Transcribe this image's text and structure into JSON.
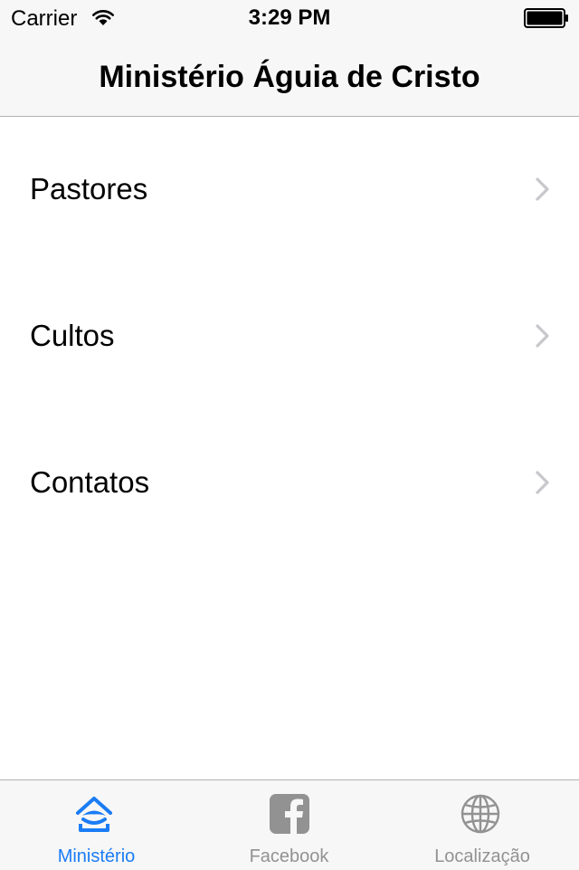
{
  "status_bar": {
    "carrier": "Carrier",
    "time": "3:29 PM"
  },
  "nav": {
    "title": "Ministério Águia de Cristo"
  },
  "list": {
    "items": [
      {
        "label": "Pastores"
      },
      {
        "label": "Cultos"
      },
      {
        "label": "Contatos"
      }
    ]
  },
  "tab_bar": {
    "tabs": [
      {
        "label": "Ministério",
        "icon": "ministerio-icon",
        "selected": true
      },
      {
        "label": "Facebook",
        "icon": "facebook-icon",
        "selected": false
      },
      {
        "label": "Localização",
        "icon": "globe-icon",
        "selected": false
      }
    ]
  },
  "colors": {
    "accent": "#1a7cf5",
    "inactive": "#929292",
    "chevron": "#c7c7cc",
    "bar_background": "#f7f7f7",
    "separator": "#b2b2b2"
  }
}
